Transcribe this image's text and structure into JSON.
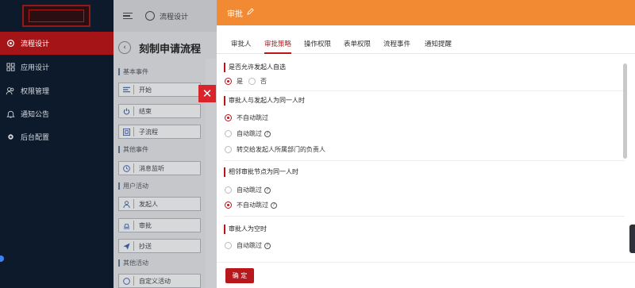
{
  "sidebar": {
    "items": [
      {
        "label": "流程设计",
        "icon": "gear-icon",
        "active": true
      },
      {
        "label": "应用设计",
        "icon": "grid-icon",
        "active": false
      },
      {
        "label": "权限管理",
        "icon": "users-icon",
        "active": false
      },
      {
        "label": "通知公告",
        "icon": "bell-icon",
        "active": false
      },
      {
        "label": "后台配置",
        "icon": "cog-icon",
        "active": false
      }
    ]
  },
  "header": {
    "title": "流程设计"
  },
  "page": {
    "title": "刻制申请流程"
  },
  "palette": {
    "groups": [
      {
        "label": "基本事件"
      },
      {
        "label": "其他事件"
      },
      {
        "label": "用户活动"
      },
      {
        "label": "其他活动"
      }
    ],
    "nodes": [
      {
        "label": "开始"
      },
      {
        "label": "结束"
      },
      {
        "label": "子流程"
      },
      {
        "label": "消息监听"
      },
      {
        "label": "发起人"
      },
      {
        "label": "审批"
      },
      {
        "label": "抄送"
      },
      {
        "label": "自定义活动"
      }
    ]
  },
  "drawer": {
    "title": "审批",
    "tabs": [
      {
        "label": "审批人",
        "active": false
      },
      {
        "label": "审批策略",
        "active": true
      },
      {
        "label": "操作权限",
        "active": false
      },
      {
        "label": "表单权限",
        "active": false
      },
      {
        "label": "流程事件",
        "active": false
      },
      {
        "label": "通知提醒",
        "active": false
      }
    ],
    "sections": [
      {
        "title": "是否允许发起人自选",
        "options": [
          {
            "label": "是",
            "checked": true
          },
          {
            "label": "否",
            "checked": false
          }
        ]
      },
      {
        "title": "审批人与发起人为同一人时",
        "options": [
          {
            "label": "不自动跳过",
            "checked": true
          },
          {
            "label": "自动跳过",
            "checked": false
          },
          {
            "label": "转交给发起人所属部门的负责人",
            "checked": false
          }
        ]
      },
      {
        "title": "相邻审批节点为同一人时",
        "options": [
          {
            "label": "自动跳过",
            "checked": false
          },
          {
            "label": "不自动跳过",
            "checked": true
          }
        ]
      },
      {
        "title": "审批人为空时",
        "options": [
          {
            "label": "自动跳过",
            "checked": false
          }
        ]
      }
    ],
    "confirm_label": "确 定"
  },
  "colors": {
    "accent": "#b8171c",
    "header": "#f28a33",
    "sidebar": "#0c1a2b"
  }
}
